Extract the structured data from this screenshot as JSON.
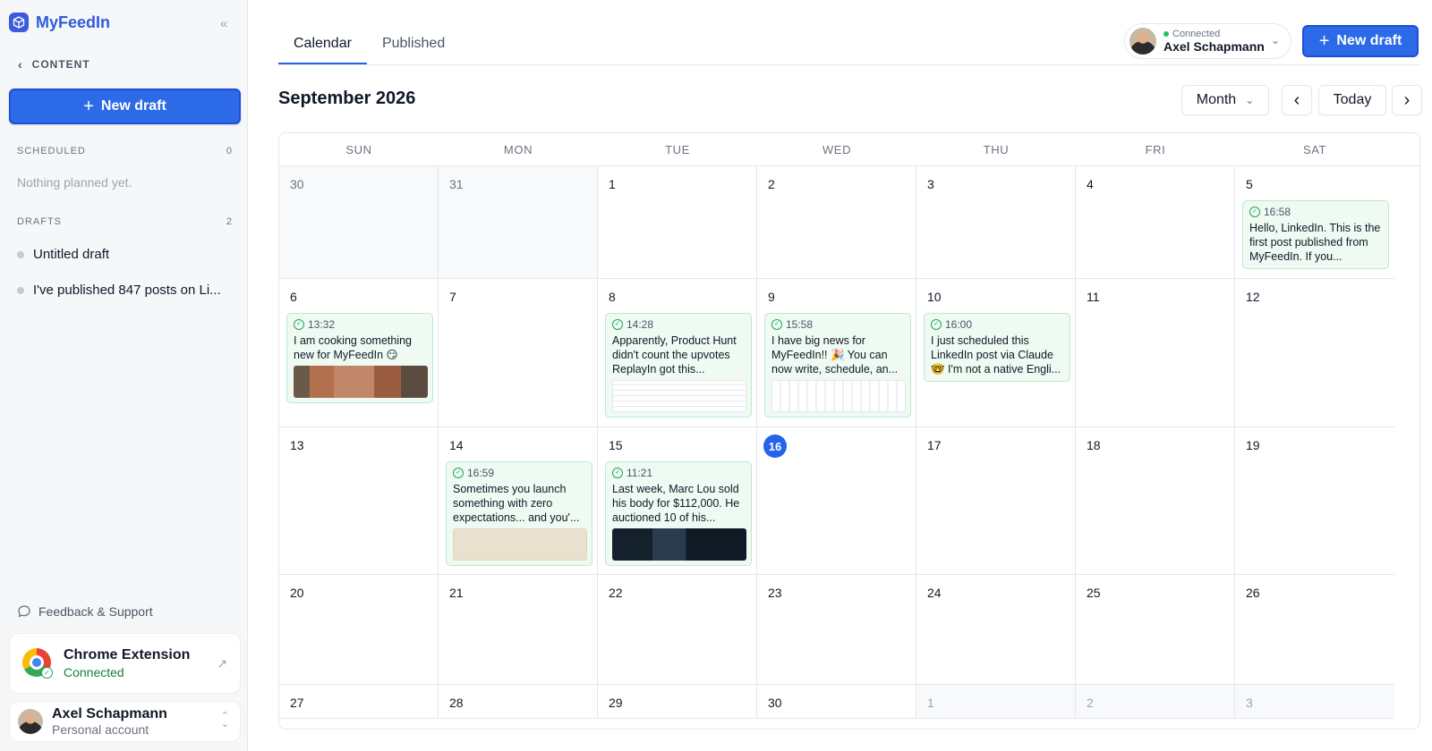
{
  "app": {
    "name": "MyFeedIn"
  },
  "sidebar": {
    "back_label": "CONTENT",
    "new_draft_label": "New draft",
    "scheduled": {
      "label": "SCHEDULED",
      "count": "0",
      "empty_text": "Nothing planned yet."
    },
    "drafts": {
      "label": "DRAFTS",
      "count": "2",
      "items": [
        "Untitled draft",
        "I've published 847 posts on Li..."
      ]
    },
    "feedback_label": "Feedback & Support",
    "extension": {
      "title": "Chrome Extension",
      "status": "Connected"
    },
    "account": {
      "name": "Axel Schapmann",
      "type": "Personal account"
    }
  },
  "header": {
    "tabs": [
      "Calendar",
      "Published"
    ],
    "active_tab": "Calendar",
    "account": {
      "status": "Connected",
      "name": "Axel Schapmann"
    },
    "new_draft_label": "New draft"
  },
  "calendar": {
    "title": "September 2026",
    "view_label": "Month",
    "today_label": "Today",
    "weekdays": [
      "SUN",
      "MON",
      "TUE",
      "WED",
      "THU",
      "FRI",
      "SAT"
    ],
    "weeks": [
      [
        {
          "day": "30",
          "other": true
        },
        {
          "day": "31",
          "other": true
        },
        {
          "day": "1"
        },
        {
          "day": "2"
        },
        {
          "day": "3"
        },
        {
          "day": "4"
        },
        {
          "day": "5",
          "post": {
            "time": "16:58",
            "text": "Hello, LinkedIn. This is the first post published from MyFeedIn. If you...",
            "thumb": ""
          }
        }
      ],
      [
        {
          "day": "6",
          "post": {
            "time": "13:32",
            "text": "I am cooking something new for MyFeedIn 😏",
            "thumb": "brick"
          }
        },
        {
          "day": "7"
        },
        {
          "day": "8",
          "post": {
            "time": "14:28",
            "text": "Apparently, Product Hunt didn't count the upvotes ReplayIn got this...",
            "thumb": "screen"
          }
        },
        {
          "day": "9",
          "post": {
            "time": "15:58",
            "text": "I have big news for MyFeedIn!! 🎉 You can now write, schedule, an...",
            "thumb": "screen2"
          }
        },
        {
          "day": "10",
          "post": {
            "time": "16:00",
            "text": "I just scheduled this LinkedIn post via Claude 🤓 I'm not a native Engli...",
            "thumb": ""
          }
        },
        {
          "day": "11"
        },
        {
          "day": "12"
        }
      ],
      [
        {
          "day": "13"
        },
        {
          "day": "14",
          "post": {
            "time": "16:59",
            "text": "Sometimes you launch something with zero expectations... and you'...",
            "thumb": "beige"
          }
        },
        {
          "day": "15",
          "post": {
            "time": "11:21",
            "text": "Last week, Marc Lou sold his body for $112,000. He auctioned 10 of his...",
            "thumb": "dark"
          }
        },
        {
          "day": "16",
          "today": true
        },
        {
          "day": "17"
        },
        {
          "day": "18"
        },
        {
          "day": "19"
        }
      ],
      [
        {
          "day": "20"
        },
        {
          "day": "21"
        },
        {
          "day": "22"
        },
        {
          "day": "23"
        },
        {
          "day": "24"
        },
        {
          "day": "25"
        },
        {
          "day": "26"
        }
      ],
      [
        {
          "day": "27"
        },
        {
          "day": "28"
        },
        {
          "day": "29"
        },
        {
          "day": "30"
        },
        {
          "day": "1",
          "other": true,
          "dim": true
        },
        {
          "day": "2",
          "other": true,
          "dim": true
        },
        {
          "day": "3",
          "other": true,
          "dim": true
        }
      ]
    ]
  },
  "colors": {
    "primary": "#2d6ae8",
    "post_bg": "#eefaf2",
    "post_border": "#bfe8cd",
    "connected_green": "#22c55e"
  }
}
